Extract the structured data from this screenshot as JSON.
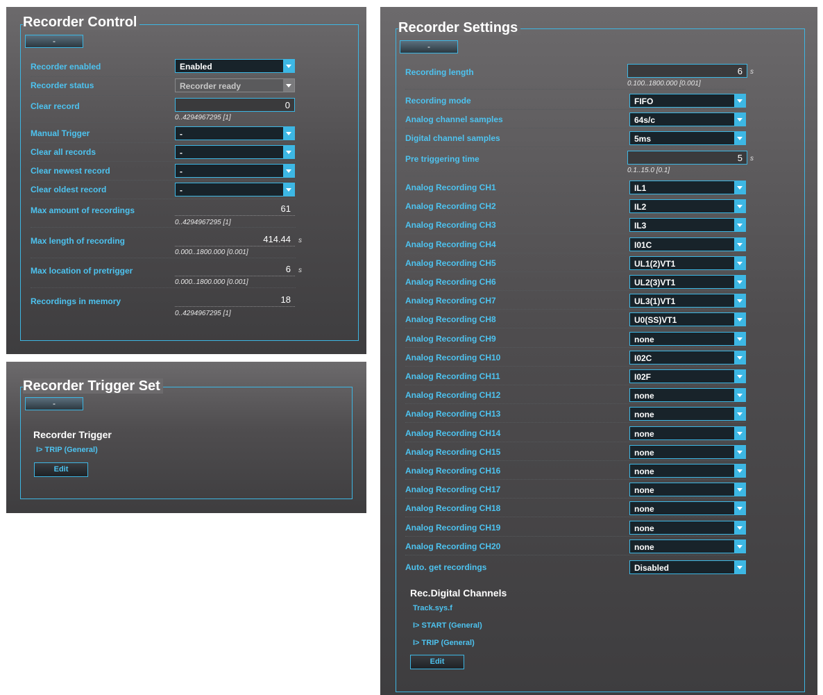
{
  "recorder_control": {
    "title": "Recorder Control",
    "collapse_label": "-",
    "rows": [
      {
        "label": "Recorder enabled",
        "value": "Enabled"
      },
      {
        "label": "Recorder status",
        "value": "Recorder ready"
      },
      {
        "label": "Clear record",
        "value": "0",
        "range": "0..4294967295 [1]"
      },
      {
        "label": "Manual Trigger",
        "value": "-"
      },
      {
        "label": "Clear all records",
        "value": "-"
      },
      {
        "label": "Clear newest record",
        "value": "-"
      },
      {
        "label": "Clear oldest record",
        "value": "-"
      },
      {
        "label": "Max amount of recordings",
        "value": "61",
        "range": "0..4294967295 [1]"
      },
      {
        "label": "Max length of recording",
        "value": "414.44",
        "unit": "s",
        "range": "0.000..1800.000 [0.001]"
      },
      {
        "label": "Max location of pretrigger",
        "value": "6",
        "unit": "s",
        "range": "0.000..1800.000 [0.001]"
      },
      {
        "label": "Recordings in memory",
        "value": "18",
        "range": "0..4294967295 [1]"
      }
    ]
  },
  "recorder_trigger_set": {
    "title": "Recorder Trigger Set",
    "collapse_label": "-",
    "section_title": "Recorder Trigger",
    "items": [
      "I> TRIP (General)"
    ],
    "edit_label": "Edit"
  },
  "recorder_settings": {
    "title": "Recorder Settings",
    "collapse_label": "-",
    "recording_length": {
      "label": "Recording length",
      "value": "6",
      "unit": "s",
      "range": "0.100..1800.000 [0.001]"
    },
    "recording_mode": {
      "label": "Recording mode",
      "value": "FIFO"
    },
    "analog_channel_samples": {
      "label": "Analog channel samples",
      "value": "64s/c"
    },
    "digital_channel_samples": {
      "label": "Digital channel samples",
      "value": "5ms"
    },
    "pre_triggering_time": {
      "label": "Pre triggering time",
      "value": "5",
      "unit": "s",
      "range": "0.1..15.0 [0.1]"
    },
    "channels": [
      {
        "label": "Analog Recording CH1",
        "value": "IL1"
      },
      {
        "label": "Analog Recording CH2",
        "value": "IL2"
      },
      {
        "label": "Analog Recording CH3",
        "value": "IL3"
      },
      {
        "label": "Analog Recording CH4",
        "value": "I01C"
      },
      {
        "label": "Analog Recording CH5",
        "value": "UL1(2)VT1"
      },
      {
        "label": "Analog Recording CH6",
        "value": "UL2(3)VT1"
      },
      {
        "label": "Analog Recording CH7",
        "value": "UL3(1)VT1"
      },
      {
        "label": "Analog Recording CH8",
        "value": "U0(SS)VT1"
      },
      {
        "label": "Analog Recording CH9",
        "value": "none"
      },
      {
        "label": "Analog Recording CH10",
        "value": "I02C"
      },
      {
        "label": "Analog Recording CH11",
        "value": "I02F"
      },
      {
        "label": "Analog Recording CH12",
        "value": "none"
      },
      {
        "label": "Analog Recording CH13",
        "value": "none"
      },
      {
        "label": "Analog Recording CH14",
        "value": "none"
      },
      {
        "label": "Analog Recording CH15",
        "value": "none"
      },
      {
        "label": "Analog Recording CH16",
        "value": "none"
      },
      {
        "label": "Analog Recording CH17",
        "value": "none"
      },
      {
        "label": "Analog Recording CH18",
        "value": "none"
      },
      {
        "label": "Analog Recording CH19",
        "value": "none"
      },
      {
        "label": "Analog Recording CH20",
        "value": "none"
      }
    ],
    "auto_get": {
      "label": "Auto. get recordings",
      "value": "Disabled"
    },
    "digital_section_title": "Rec.Digital Channels",
    "digital_items": [
      "Track.sys.f",
      "I> START (General)",
      "I> TRIP (General)"
    ],
    "edit_label": "Edit"
  },
  "colors": {
    "accent": "#3db7e4",
    "label": "#4dc3f0",
    "panel_top": "#6c6a6c",
    "panel_bottom": "#3e3d3f"
  }
}
